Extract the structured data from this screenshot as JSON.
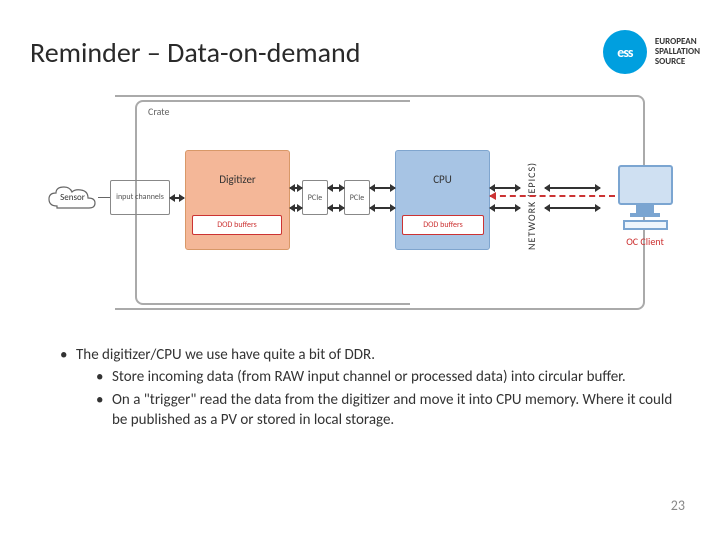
{
  "header": {
    "title": "Reminder – Data-on-demand",
    "logo_mark": "ess",
    "logo_line1": "EUROPEAN",
    "logo_line2": "SPALLATION",
    "logo_line3": "SOURCE"
  },
  "diagram": {
    "crate_label": "Crate",
    "sensor": "Sensor",
    "input_channels": "input channels",
    "digitizer": "Digitizer",
    "dod_buffer": "DOD buffers",
    "pcie": "PCIe",
    "cpu": "CPU",
    "network": "NETWORK (EPICS)",
    "oc_client": "OC Client"
  },
  "bullets": {
    "b1": "The digitizer/CPU we use have quite a bit of DDR.",
    "b1a": "Store incoming data (from RAW input channel or processed data) into circular buffer.",
    "b1b": "On a \"trigger\" read the data from the digitizer and move it into CPU memory. Where it could be published as a PV or stored in local storage."
  },
  "page_number": "23"
}
